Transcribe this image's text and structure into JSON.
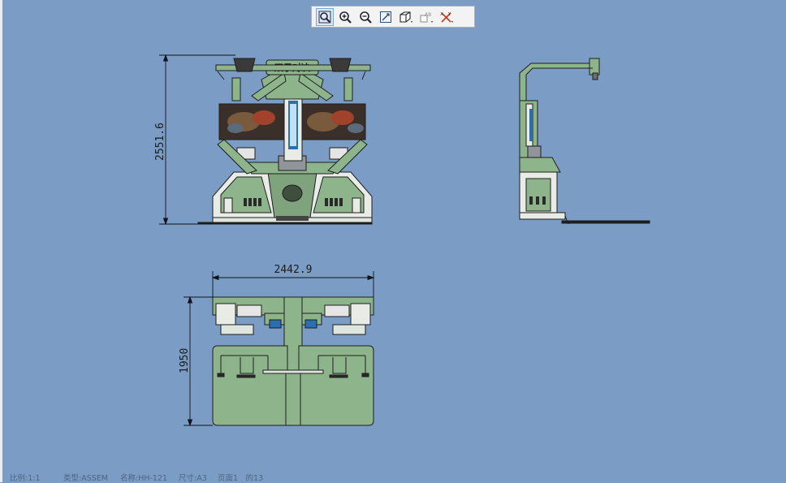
{
  "toolbar": {
    "buttons": [
      {
        "name": "zoom-window",
        "icon": "magnifier-box-icon"
      },
      {
        "name": "zoom-in",
        "icon": "zoom-in-icon"
      },
      {
        "name": "zoom-out",
        "icon": "zoom-out-icon"
      },
      {
        "name": "zoom-fit",
        "icon": "zoom-fit-icon"
      },
      {
        "name": "view-orientation",
        "icon": "cube-icon"
      },
      {
        "name": "display-text",
        "icon": "text-ab-icon"
      },
      {
        "name": "hide-show",
        "icon": "cross-xy-icon"
      }
    ]
  },
  "drawing": {
    "front_view": {
      "height_dim": "2551.6",
      "sign_text": "双子对决"
    },
    "top_view": {
      "width_dim": "2442.9",
      "depth_dim": "1950"
    }
  },
  "status_bar": {
    "scale": "比例:1:1",
    "type": "类型:ASSEM",
    "name": "名称:HH-121",
    "size": "尺寸:A3",
    "page": "页面1　的13"
  },
  "colors": {
    "background": "#7b9cc4",
    "body_green": "#8db48a",
    "outline": "#1e1e1e",
    "dimension": "#10141c"
  }
}
